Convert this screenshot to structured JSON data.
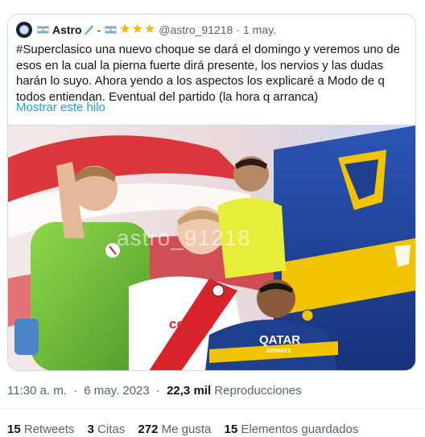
{
  "quoted_tweet": {
    "display_name": "Astro",
    "name_suffix": "-",
    "handle": "@astro_91218",
    "separator": "·",
    "date": "1 may.",
    "text": "#Superclasico una nuevo choque se dará el domingo y veremos uno de esos en la cual la pierna fuerte dirá presente, los nervios y las dudas harán lo suyo. Ahora yendo a los aspectos los explicaré a Modo de q todos entiendan. Eventual del partido (la hora q arranca)",
    "show_thread": "Mostrar este hilo",
    "stars_count": 3,
    "media": {
      "watermark": "astro_91218",
      "shirt_sponsor": "QATAR",
      "shirt_sponsor_sub": "AIRWAYS",
      "river_sponsor": "codere"
    }
  },
  "tweet_meta": {
    "time": "11:30 a. m.",
    "separator": "·",
    "date": "6 may. 2023",
    "separator2": "·",
    "views_count": "22,3 mil",
    "views_label": "Reproducciones"
  },
  "stats": [
    {
      "num": "15",
      "label": "Retweets"
    },
    {
      "num": "3",
      "label": "Citas"
    },
    {
      "num": "272",
      "label": "Me gusta"
    },
    {
      "num": "15",
      "label": "Elementos guardados"
    }
  ],
  "colors": {
    "link": "#1d9bf0",
    "muted": "#536471",
    "border": "#cfd9de",
    "river_red": "#d8232a",
    "boca_blue": "#1f3f8f",
    "boca_yellow": "#f2c300"
  }
}
